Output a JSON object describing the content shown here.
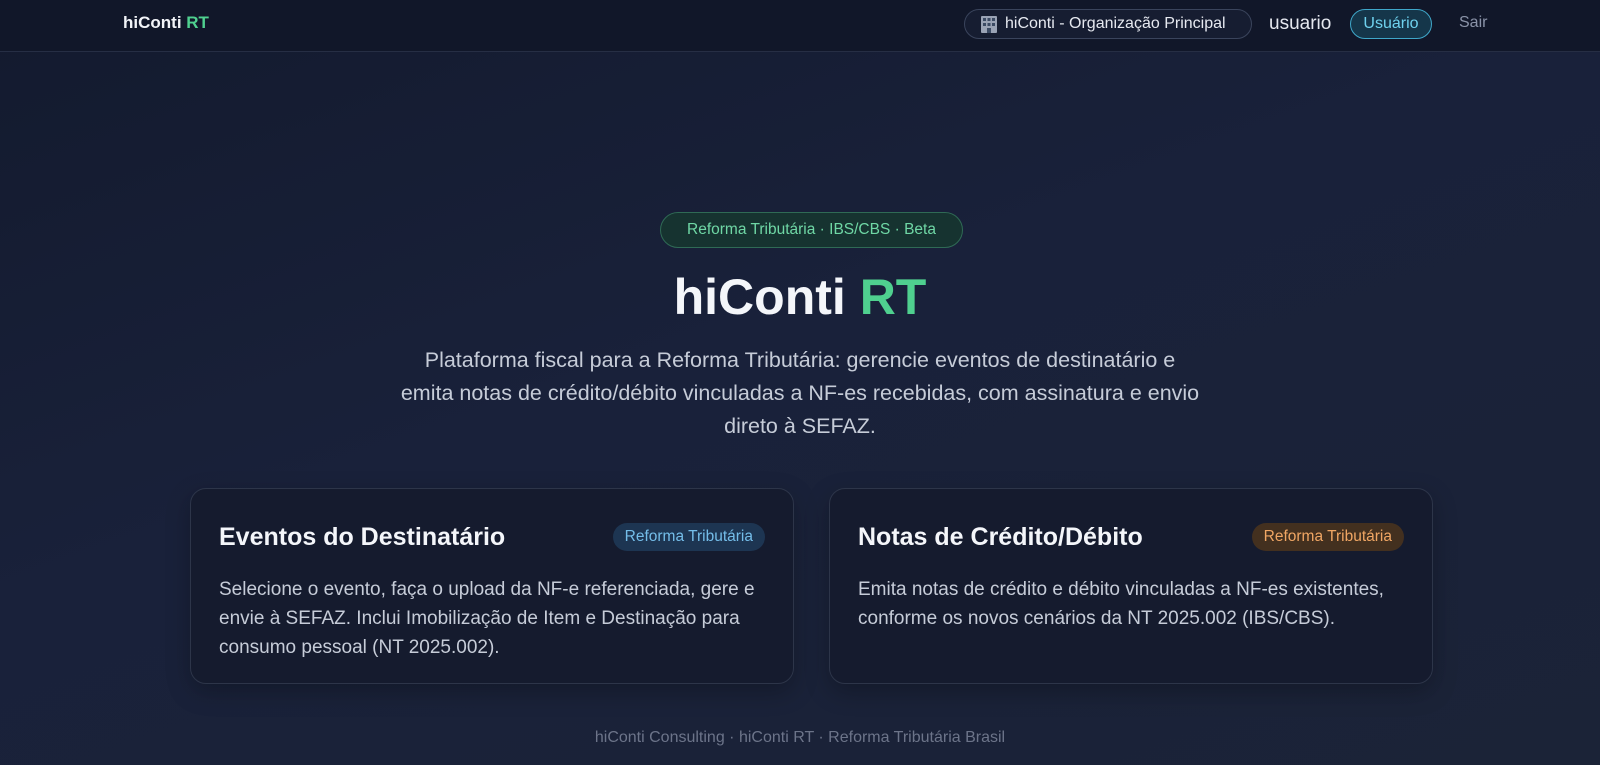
{
  "header": {
    "brand_main": "hiConti",
    "brand_accent": "RT",
    "org_icon": "office-building-icon",
    "org_label": "hiConti - Organização Principal",
    "username": "usuario",
    "role_label": "Usuário",
    "logout_label": "Sair"
  },
  "hero": {
    "badge": "Reforma Tributária · IBS/CBS · Beta",
    "title_main": "hiConti",
    "title_accent": "RT",
    "description": "Plataforma fiscal para a Reforma Tributária: gerencie eventos de destinatário e emita notas de crédito/débito vinculadas a NF-es recebidas, com assinatura e envio direto à SEFAZ."
  },
  "cards": [
    {
      "title": "Eventos do Destinatário",
      "tag": "Reforma Tributária",
      "text": "Selecione o evento, faça o upload da NF-e referenciada, gere e envie à SEFAZ. Inclui Imobilização de Item e Destinação para consumo pessoal (NT 2025.002)."
    },
    {
      "title": "Notas de Crédito/Débito",
      "tag": "Reforma Tributária",
      "text": "Emita notas de crédito e débito vinculadas a NF-es existentes, conforme os novos cenários da NT 2025.002 (IBS/CBS)."
    }
  ],
  "footer": {
    "text": "hiConti Consulting · hiConti RT · Reforma Tributária Brasil"
  },
  "colors": {
    "accent_green": "#4fd08f",
    "tag_blue_text": "#74bde9",
    "tag_orange_text": "#f0a664",
    "role_pill_text": "#6fd2ee"
  }
}
